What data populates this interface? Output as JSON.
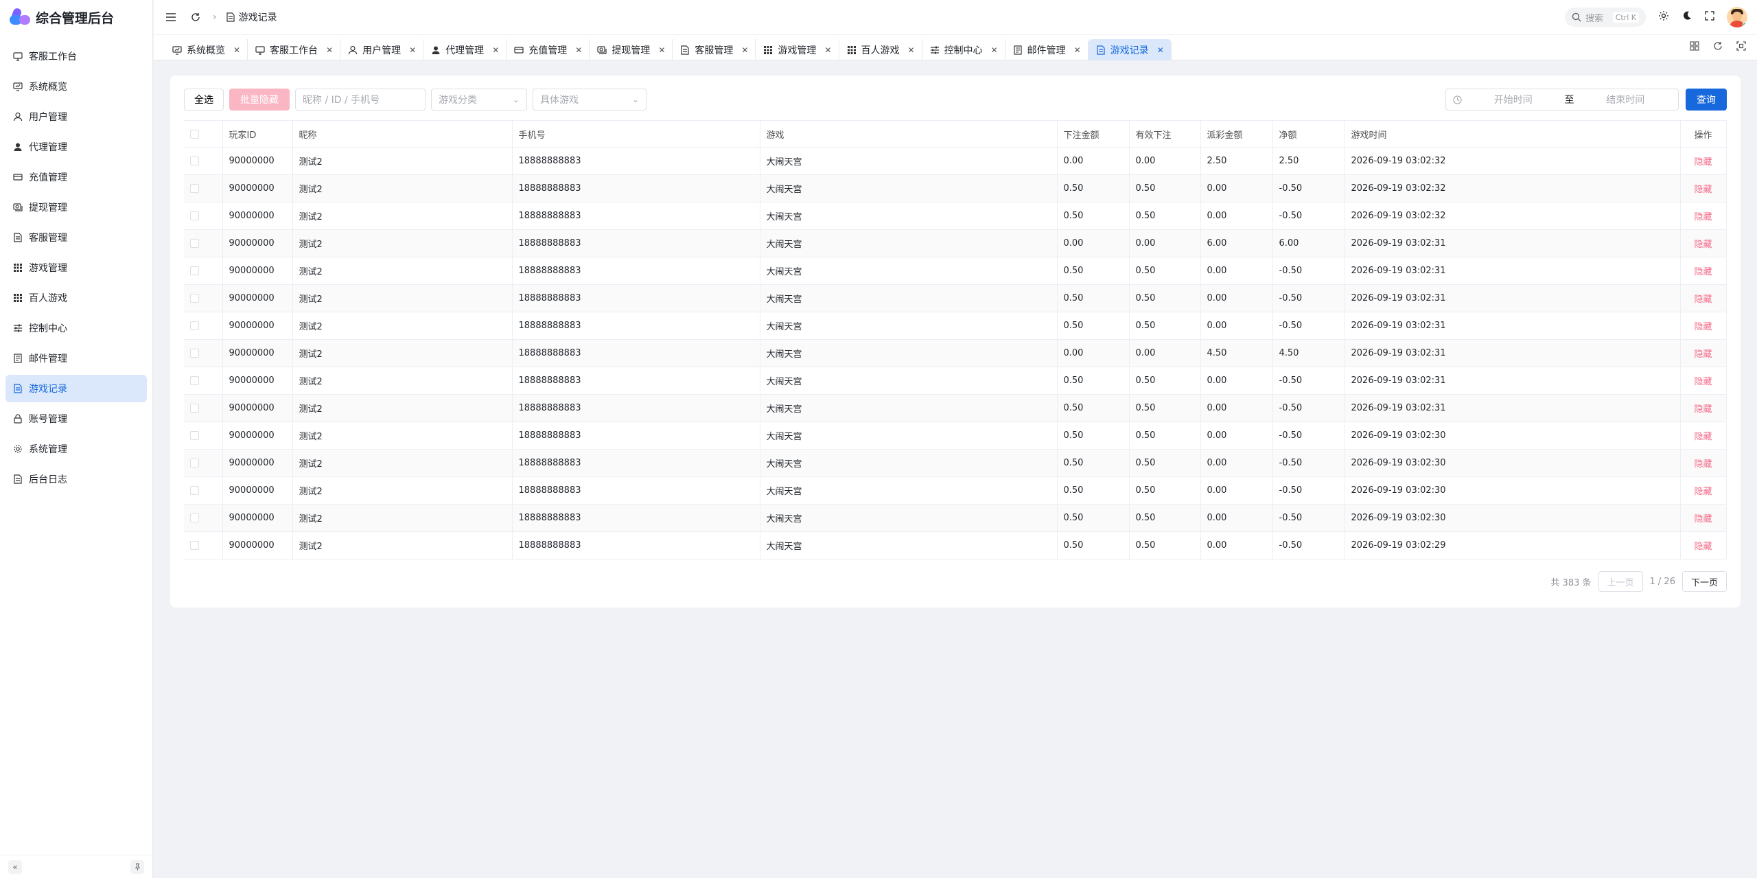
{
  "app": {
    "title": "综合管理后台"
  },
  "sidebar": {
    "items": [
      {
        "label": "客服工作台",
        "icon": "monitor-icon"
      },
      {
        "label": "系统概览",
        "icon": "dashboard-icon"
      },
      {
        "label": "用户管理",
        "icon": "user-icon"
      },
      {
        "label": "代理管理",
        "icon": "agent-icon"
      },
      {
        "label": "充值管理",
        "icon": "card-icon"
      },
      {
        "label": "提现管理",
        "icon": "cash-icon"
      },
      {
        "label": "客服管理",
        "icon": "doc-icon"
      },
      {
        "label": "游戏管理",
        "icon": "grid-icon"
      },
      {
        "label": "百人游戏",
        "icon": "grid-icon"
      },
      {
        "label": "控制中心",
        "icon": "sliders-icon"
      },
      {
        "label": "邮件管理",
        "icon": "mail-icon"
      },
      {
        "label": "游戏记录",
        "icon": "doc-icon"
      },
      {
        "label": "账号管理",
        "icon": "lock-icon"
      },
      {
        "label": "系统管理",
        "icon": "gear-icon"
      },
      {
        "label": "后台日志",
        "icon": "doc-icon"
      }
    ],
    "active_index": 11
  },
  "header": {
    "breadcrumb": "游戏记录",
    "search_label": "搜索",
    "search_shortcut": "Ctrl K"
  },
  "tabs": [
    {
      "label": "系统概览",
      "active": false
    },
    {
      "label": "客服工作台",
      "active": false
    },
    {
      "label": "用户管理",
      "active": false
    },
    {
      "label": "代理管理",
      "active": false
    },
    {
      "label": "充值管理",
      "active": false
    },
    {
      "label": "提现管理",
      "active": false
    },
    {
      "label": "客服管理",
      "active": false
    },
    {
      "label": "游戏管理",
      "active": false
    },
    {
      "label": "百人游戏",
      "active": false
    },
    {
      "label": "控制中心",
      "active": false
    },
    {
      "label": "邮件管理",
      "active": false
    },
    {
      "label": "游戏记录",
      "active": true
    }
  ],
  "toolbar": {
    "select_all": "全选",
    "batch_hide": "批量隐藏",
    "search_placeholder": "昵称 / ID / 手机号",
    "category_placeholder": "游戏分类",
    "game_placeholder": "具体游戏",
    "start_placeholder": "开始时间",
    "range_sep": "至",
    "end_placeholder": "结束时间",
    "query": "查询"
  },
  "table": {
    "columns": [
      "玩家ID",
      "昵称",
      "手机号",
      "游戏",
      "下注金额",
      "有效下注",
      "派彩金额",
      "净额",
      "游戏时间",
      "操作"
    ],
    "action_label": "隐藏",
    "rows": [
      [
        "90000000",
        "测试2",
        "18888888883",
        "大闹天宫",
        "0.00",
        "0.00",
        "2.50",
        "2.50",
        "2026-09-19 03:02:32"
      ],
      [
        "90000000",
        "测试2",
        "18888888883",
        "大闹天宫",
        "0.50",
        "0.50",
        "0.00",
        "-0.50",
        "2026-09-19 03:02:32"
      ],
      [
        "90000000",
        "测试2",
        "18888888883",
        "大闹天宫",
        "0.50",
        "0.50",
        "0.00",
        "-0.50",
        "2026-09-19 03:02:32"
      ],
      [
        "90000000",
        "测试2",
        "18888888883",
        "大闹天宫",
        "0.00",
        "0.00",
        "6.00",
        "6.00",
        "2026-09-19 03:02:31"
      ],
      [
        "90000000",
        "测试2",
        "18888888883",
        "大闹天宫",
        "0.50",
        "0.50",
        "0.00",
        "-0.50",
        "2026-09-19 03:02:31"
      ],
      [
        "90000000",
        "测试2",
        "18888888883",
        "大闹天宫",
        "0.50",
        "0.50",
        "0.00",
        "-0.50",
        "2026-09-19 03:02:31"
      ],
      [
        "90000000",
        "测试2",
        "18888888883",
        "大闹天宫",
        "0.50",
        "0.50",
        "0.00",
        "-0.50",
        "2026-09-19 03:02:31"
      ],
      [
        "90000000",
        "测试2",
        "18888888883",
        "大闹天宫",
        "0.00",
        "0.00",
        "4.50",
        "4.50",
        "2026-09-19 03:02:31"
      ],
      [
        "90000000",
        "测试2",
        "18888888883",
        "大闹天宫",
        "0.50",
        "0.50",
        "0.00",
        "-0.50",
        "2026-09-19 03:02:31"
      ],
      [
        "90000000",
        "测试2",
        "18888888883",
        "大闹天宫",
        "0.50",
        "0.50",
        "0.00",
        "-0.50",
        "2026-09-19 03:02:31"
      ],
      [
        "90000000",
        "测试2",
        "18888888883",
        "大闹天宫",
        "0.50",
        "0.50",
        "0.00",
        "-0.50",
        "2026-09-19 03:02:30"
      ],
      [
        "90000000",
        "测试2",
        "18888888883",
        "大闹天宫",
        "0.50",
        "0.50",
        "0.00",
        "-0.50",
        "2026-09-19 03:02:30"
      ],
      [
        "90000000",
        "测试2",
        "18888888883",
        "大闹天宫",
        "0.50",
        "0.50",
        "0.00",
        "-0.50",
        "2026-09-19 03:02:30"
      ],
      [
        "90000000",
        "测试2",
        "18888888883",
        "大闹天宫",
        "0.50",
        "0.50",
        "0.00",
        "-0.50",
        "2026-09-19 03:02:30"
      ],
      [
        "90000000",
        "测试2",
        "18888888883",
        "大闹天宫",
        "0.50",
        "0.50",
        "0.00",
        "-0.50",
        "2026-09-19 03:02:29"
      ]
    ]
  },
  "pagination": {
    "total": "共 383 条",
    "prev": "上一页",
    "page": "1 / 26",
    "next": "下一页"
  },
  "colors": {
    "primary": "#1668dc",
    "active_bg": "#dbe8fb",
    "danger_link": "#f56c8a"
  }
}
